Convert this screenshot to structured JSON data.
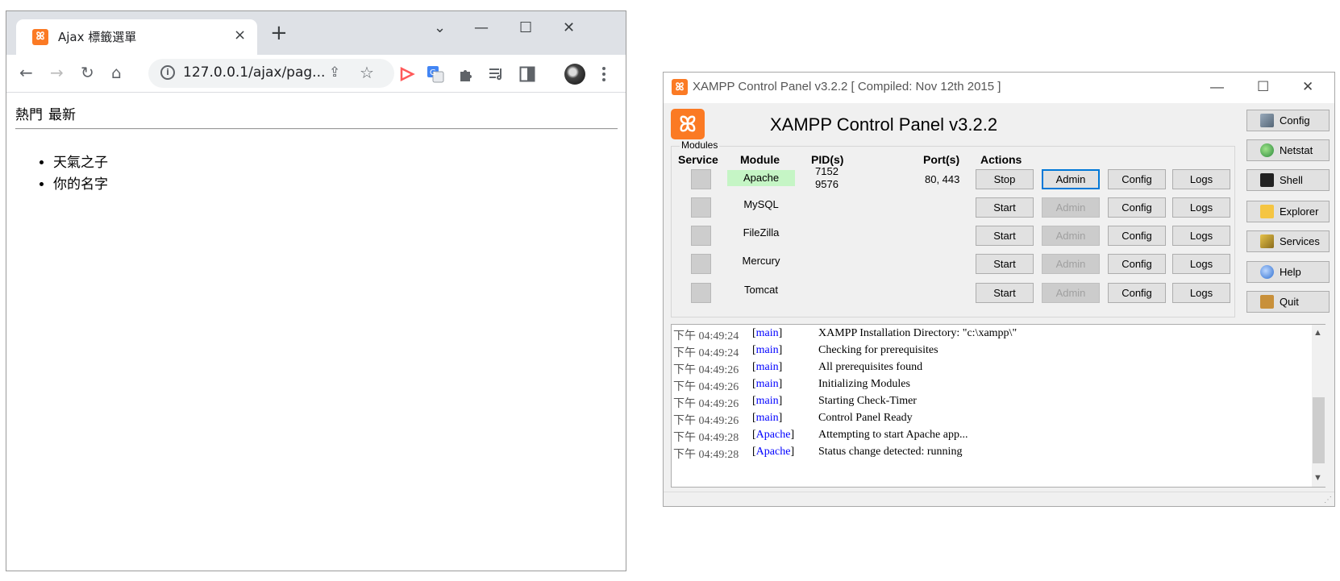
{
  "browser": {
    "tab_title": "Ajax 標籤選單",
    "tab_favicon": "xampp-icon",
    "tab_close": "×",
    "new_tab": "+",
    "window_controls": {
      "tabsearch": "⌄",
      "minimize": "—",
      "maximize": "☐",
      "close": "✕"
    },
    "nav": {
      "back": "←",
      "forward": "→",
      "reload": "↻",
      "home": "⌂"
    },
    "address": "127.0.0.1/ajax/pag...",
    "page": {
      "tabs": [
        "熱門",
        "最新"
      ],
      "items": [
        "天氣之子",
        "你的名字"
      ]
    }
  },
  "xampp": {
    "window_title": "XAMPP Control Panel v3.2.2   [ Compiled: Nov 12th 2015 ]",
    "heading": "XAMPP Control Panel v3.2.2",
    "modules_legend": "Modules",
    "columns": {
      "service": "Service",
      "module": "Module",
      "pids": "PID(s)",
      "ports": "Port(s)",
      "actions": "Actions"
    },
    "modules": [
      {
        "name": "Apache",
        "pid1": "7152",
        "pid2": "9576",
        "ports": "80, 443",
        "action": "Stop",
        "admin": "Admin",
        "config": "Config",
        "logs": "Logs"
      },
      {
        "name": "MySQL",
        "pid1": "",
        "pid2": "",
        "ports": "",
        "action": "Start",
        "admin": "Admin",
        "config": "Config",
        "logs": "Logs"
      },
      {
        "name": "FileZilla",
        "pid1": "",
        "pid2": "",
        "ports": "",
        "action": "Start",
        "admin": "Admin",
        "config": "Config",
        "logs": "Logs"
      },
      {
        "name": "Mercury",
        "pid1": "",
        "pid2": "",
        "ports": "",
        "action": "Start",
        "admin": "Admin",
        "config": "Config",
        "logs": "Logs"
      },
      {
        "name": "Tomcat",
        "pid1": "",
        "pid2": "",
        "ports": "",
        "action": "Start",
        "admin": "Admin",
        "config": "Config",
        "logs": "Logs"
      }
    ],
    "side_buttons": [
      "Config",
      "Netstat",
      "Shell",
      "Explorer",
      "Services",
      "Help",
      "Quit"
    ],
    "log": [
      {
        "time": "下午 04:49:24",
        "module": "main",
        "text": "XAMPP Installation Directory: \"c:\\xampp\\\""
      },
      {
        "time": "下午 04:49:24",
        "module": "main",
        "text": "Checking for prerequisites"
      },
      {
        "time": "下午 04:49:26",
        "module": "main",
        "text": "All prerequisites found"
      },
      {
        "time": "下午 04:49:26",
        "module": "main",
        "text": "Initializing Modules"
      },
      {
        "time": "下午 04:49:26",
        "module": "main",
        "text": "Starting Check-Timer"
      },
      {
        "time": "下午 04:49:26",
        "module": "main",
        "text": "Control Panel Ready"
      },
      {
        "time": "下午 04:49:28",
        "module": "Apache",
        "text": "Attempting to start Apache app..."
      },
      {
        "time": "下午 04:49:28",
        "module": "Apache",
        "text": "Status change detected: running"
      }
    ],
    "colors": {
      "running_bg": "#c5f5c5",
      "log_module": "#0000ff",
      "focus_border": "#0078d7"
    }
  }
}
